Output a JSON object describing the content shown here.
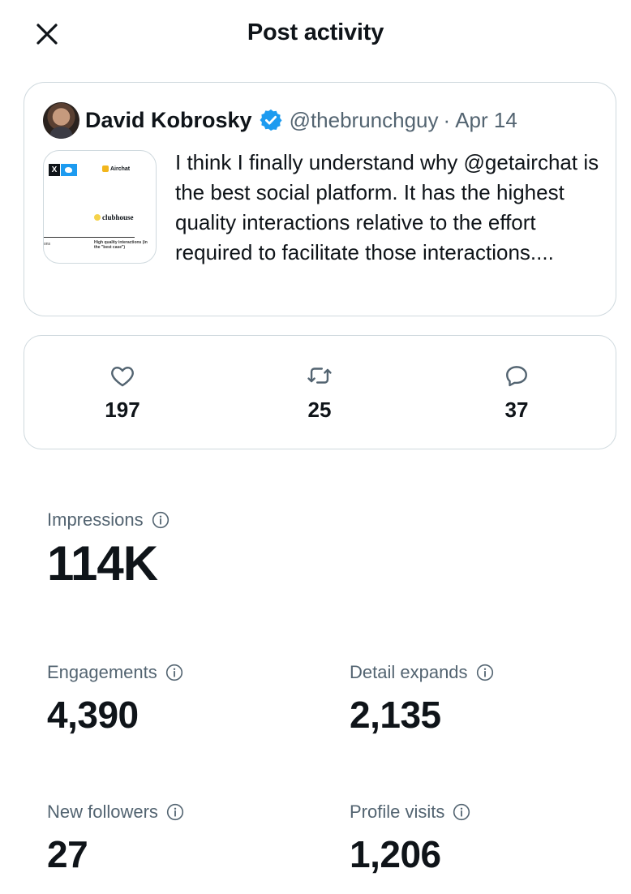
{
  "header": {
    "title": "Post activity",
    "close_icon": "close-icon"
  },
  "post": {
    "author_name": "David Kobrosky",
    "handle": "@thebrunchguy",
    "separator": "·",
    "date": "Apr 14",
    "text": "I think I finally understand why @getairchat is the best social platform. It has the highest quality interactions relative to the effort required to facilitate those interactions....",
    "thumbnail": {
      "x_label": "X",
      "airchat_label": "Airchat",
      "clubhouse_label": "clubhouse",
      "left_axis_label": "ons",
      "right_axis_label": "High quality interactions (in the \"best case\")"
    },
    "colors": {
      "verified": "#1d9bf0",
      "muted": "#536471"
    }
  },
  "engagement": {
    "likes": {
      "icon": "heart-icon",
      "value": "197"
    },
    "reposts": {
      "icon": "repost-icon",
      "value": "25"
    },
    "replies": {
      "icon": "reply-icon",
      "value": "37"
    }
  },
  "stats": {
    "impressions": {
      "label": "Impressions",
      "value": "114K"
    },
    "engagements": {
      "label": "Engagements",
      "value": "4,390"
    },
    "detail_expands": {
      "label": "Detail expands",
      "value": "2,135"
    },
    "new_followers": {
      "label": "New followers",
      "value": "27"
    },
    "profile_visits": {
      "label": "Profile visits",
      "value": "1,206"
    }
  }
}
